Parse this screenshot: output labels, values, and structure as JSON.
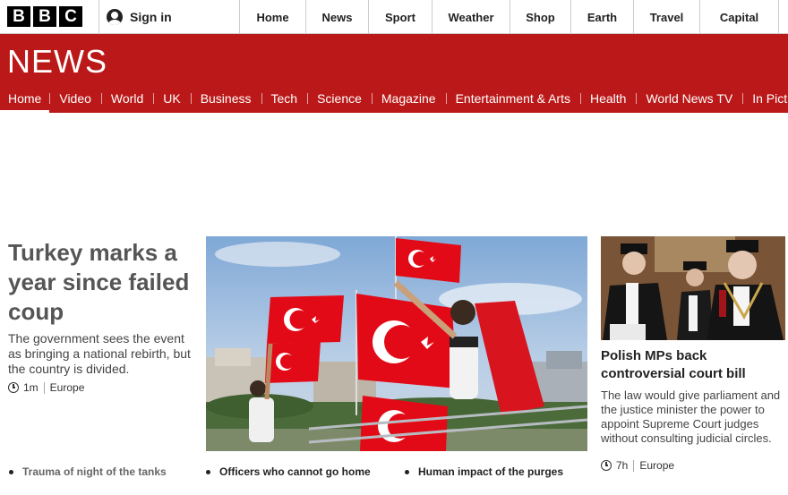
{
  "topbar": {
    "logo_letters": [
      "B",
      "B",
      "C"
    ],
    "signin_label": "Sign in",
    "nav": [
      "Home",
      "News",
      "Sport",
      "Weather",
      "Shop",
      "Earth",
      "Travel",
      "Capital"
    ]
  },
  "masthead": {
    "brand": "NEWS",
    "sections": [
      "Home",
      "Video",
      "World",
      "UK",
      "Business",
      "Tech",
      "Science",
      "Magazine",
      "Entertainment & Arts",
      "Health",
      "World News TV",
      "In Pictures"
    ],
    "active_section": "Home",
    "color": "#bb1919"
  },
  "lead_story": {
    "headline": "Turkey marks a year since failed coup",
    "summary": "The government sees the event as bringing a national rebirth, but the country is divided.",
    "time": "1m",
    "section": "Europe"
  },
  "side_story": {
    "headline": "Polish MPs back controversial court bill",
    "summary": "The law would give parliament and the justice minister the power to appoint Supreme Court judges without consulting judicial circles.",
    "time": "7h",
    "section": "Europe"
  },
  "related_links": [
    "Trauma of night of the tanks",
    "Officers who cannot go home",
    "Human impact of the purges"
  ],
  "icons": {
    "signin": "user-avatar-icon",
    "timestamp": "clock-icon"
  }
}
